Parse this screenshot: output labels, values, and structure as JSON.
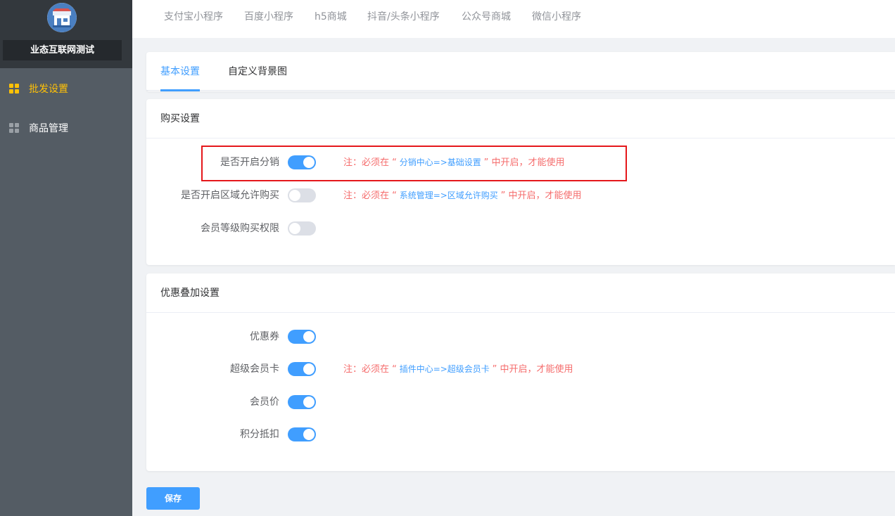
{
  "brand": {
    "name": "业态互联网测试",
    "logo_icon": "shop-icon"
  },
  "sidebar": {
    "items": [
      {
        "label": "批发设置",
        "icon": "grid-icon",
        "active": true
      },
      {
        "label": "商品管理",
        "icon": "grid-icon",
        "active": false
      }
    ]
  },
  "top_tabs": [
    "支付宝小程序",
    "百度小程序",
    "h5商城",
    "抖音/头条小程序",
    "公众号商城",
    "微信小程序"
  ],
  "sub_tabs": [
    {
      "label": "基本设置",
      "active": true
    },
    {
      "label": "自定义背景图",
      "active": false
    }
  ],
  "buy_settings": {
    "title": "购买设置",
    "rows": [
      {
        "label": "是否开启分销",
        "on": true,
        "note_prefix": "注：必须在 “",
        "note_path": " 分销中心=>基础设置 ",
        "note_suffix": "” 中开启，才能使用"
      },
      {
        "label": "是否开启区域允许购买",
        "on": false,
        "note_prefix": "注：必须在 “",
        "note_path": " 系统管理=>区域允许购买 ",
        "note_suffix": "” 中开启，才能使用"
      },
      {
        "label": "会员等级购买权限",
        "on": false
      }
    ]
  },
  "discount_settings": {
    "title": "优惠叠加设置",
    "rows": [
      {
        "label": "优惠券",
        "on": true
      },
      {
        "label": "超级会员卡",
        "on": true,
        "note_prefix": "注：必须在 “",
        "note_path": " 插件中心=>超级会员卡 ",
        "note_suffix": "” 中开启，才能使用"
      },
      {
        "label": "会员价",
        "on": true
      },
      {
        "label": "积分抵扣",
        "on": true
      }
    ]
  },
  "save_label": "保存",
  "colors": {
    "sidebar_bg": "#545c64",
    "brand_bg": "#33383d",
    "active_nav": "#ffc107",
    "primary": "#409eff",
    "note_red": "#f56c6c",
    "highlight_red": "#e5171b"
  }
}
